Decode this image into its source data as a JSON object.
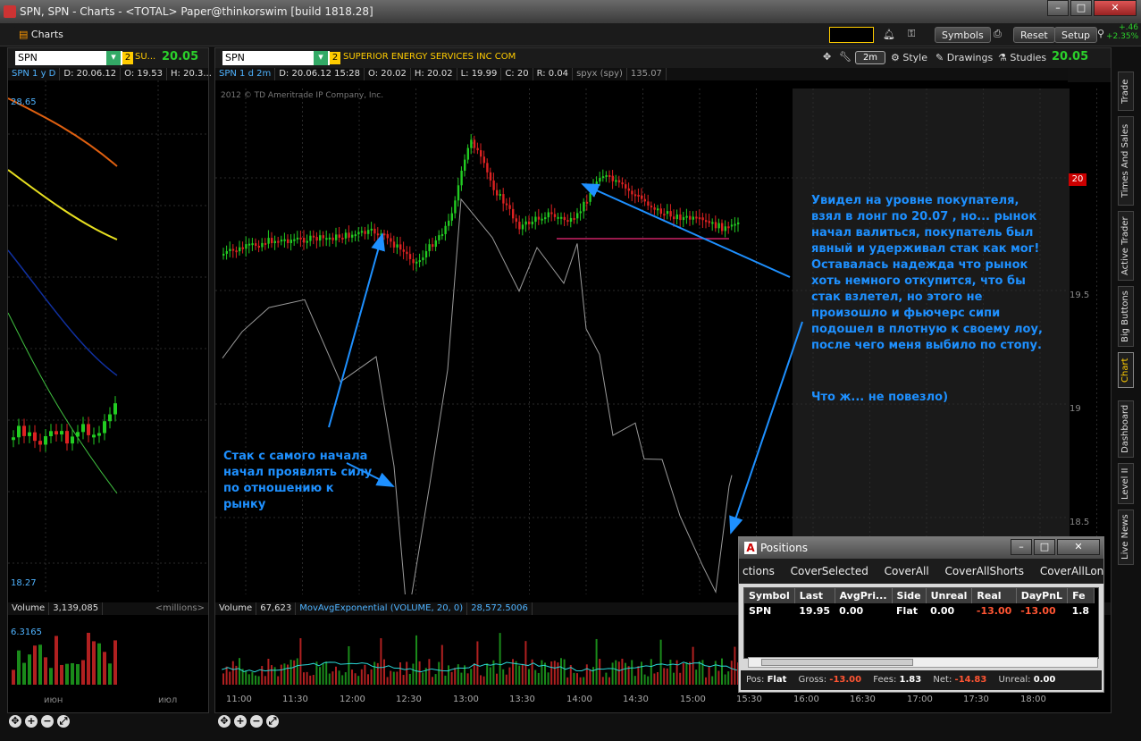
{
  "window": {
    "title": "SPN, SPN - Charts - <TOTAL> Paper@thinkorswim [build 1818.28]"
  },
  "appbar": {
    "charts_tab": "Charts",
    "buttons": {
      "symbols": "Symbols",
      "reset": "Reset",
      "setup": "Setup"
    },
    "change": "+.46",
    "change_pct": "+2.35%"
  },
  "left_chart": {
    "symbol": "SPN",
    "link": "2",
    "desc": "SU...",
    "price": "20.05",
    "header": {
      "period": "SPN 1 y D",
      "date": "D: 20.06.12",
      "open": "O: 19.53",
      "high": "H: 20.3..."
    },
    "y_top": "28.65",
    "y_bottom": "18.27",
    "volume": {
      "label": "Volume",
      "value": "3,139,085",
      "units": "<millions>",
      "top": "6.3165"
    },
    "months": [
      "июн",
      "июл"
    ]
  },
  "main_chart": {
    "symbol": "SPN",
    "link": "2",
    "desc": "SUPERIOR ENERGY SERVICES INC COM",
    "toolbar": {
      "interval": "2m",
      "style": "Style",
      "drawings": "Drawings",
      "studies": "Studies",
      "price": "20.05"
    },
    "header": {
      "period": "SPN 1 d 2m",
      "date": "D: 20.06.12 15:28",
      "open": "O: 20.02",
      "high": "H: 20.02",
      "low": "L: 19.99",
      "close": "C: 20",
      "range": "R: 0.04",
      "compare": "spyx (spy)",
      "compare_val": "135.07"
    },
    "copyright": "2012 © TD Ameritrade IP Company, Inc.",
    "price_labels": [
      "19.5",
      "19",
      "18.5"
    ],
    "last_price": "20",
    "volume": {
      "label": "Volume",
      "value": "67,623",
      "study": "MovAvgExponential (VOLUME, 20, 0)",
      "study_value": "28,572.5006"
    },
    "times": [
      "11:00",
      "11:30",
      "12:00",
      "12:30",
      "13:00",
      "13:30",
      "14:00",
      "14:30",
      "15:00",
      "15:30",
      "16:00",
      "16:30",
      "17:00",
      "17:30",
      "18:00"
    ]
  },
  "annotations": {
    "left": "Стак с самого начала начал проявлять силу по отношению к рынку",
    "right": "Увидел на уровне покупателя, взял в лонг по 20.07 , но... рынок начал валиться, покупатель был явный и удерживал стак как мог! Оставалась надежда что рынок хоть немного откупится, что бы стак взлетел, но этого не произошло и фьючерс сипи подошел в плотную к своему лоу, после чего меня выбило по стопу.",
    "right2": "Что ж... не повезло)"
  },
  "sidebar_tabs": [
    "Trade",
    "Times And Sales",
    "Active Trader",
    "Big Buttons",
    "Chart",
    "Dashboard",
    "Level II",
    "Live News"
  ],
  "positions": {
    "title": "Positions",
    "actions": [
      "ctions",
      "CoverSelected",
      "CoverAll",
      "CoverAllShorts",
      "CoverAllLongs"
    ],
    "columns": [
      "Symbol",
      "Last",
      "AvgPri...",
      "Side",
      "Unreal",
      "Real",
      "DayPnL",
      "Fe"
    ],
    "rows": [
      {
        "symbol": "SPN",
        "last": "19.95",
        "avg": "0.00",
        "side": "Flat",
        "unreal": "0.00",
        "real": "-13.00",
        "daypnl": "-13.00",
        "fees": "1.8"
      }
    ],
    "footer": {
      "pos_label": "Pos:",
      "pos": "Flat",
      "gross_label": "Gross:",
      "gross": "-13.00",
      "fees_label": "Fees:",
      "fees": "1.83",
      "net_label": "Net:",
      "net": "-14.83",
      "unreal_label": "Unreal:",
      "unreal": "0.00"
    }
  },
  "colors": {
    "up": "#22cc22",
    "down": "#dd2222",
    "accent": "#1e90ff",
    "price": "#2bd02b"
  }
}
